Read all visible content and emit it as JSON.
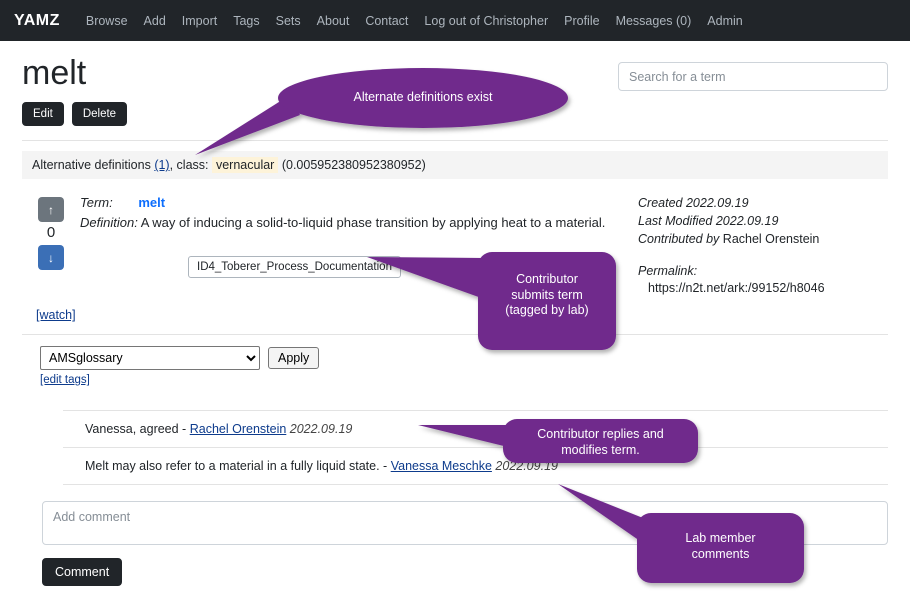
{
  "navbar": {
    "brand": "YAMZ",
    "items": [
      {
        "label": "Browse"
      },
      {
        "label": "Add"
      },
      {
        "label": "Import"
      },
      {
        "label": "Tags"
      },
      {
        "label": "Sets"
      },
      {
        "label": "About"
      },
      {
        "label": "Contact"
      },
      {
        "label": "Log out of Christopher"
      },
      {
        "label": "Profile"
      },
      {
        "label": "Messages (0)"
      },
      {
        "label": "Admin"
      }
    ]
  },
  "page": {
    "title": "melt",
    "edit_label": "Edit",
    "delete_label": "Delete"
  },
  "search": {
    "placeholder": "Search for a term",
    "value": ""
  },
  "alt_definitions": {
    "prefix": "Alternative definitions",
    "count_link": "(1)",
    "class_label": ", class:",
    "class_value": "vernacular",
    "score": "(0.005952380952380952)"
  },
  "term": {
    "vote_up_icon": "arrow-up-icon",
    "vote_down_icon": "arrow-down-icon",
    "vote_count": "0",
    "term_label": "Term:",
    "term_value": "melt",
    "definition_label": "Definition:",
    "definition_value": "A way of inducing a solid-to-liquid phase transition by applying heat to a material.",
    "tag_chip": "ID4_Toberer_Process_Documentation",
    "tag_remove_icon": "close-x-icon",
    "watch_link": "[watch]"
  },
  "meta": {
    "created_label": "Created",
    "created_value": "2022.09.19",
    "modified_label": "Last Modified",
    "modified_value": "2022.09.19",
    "contributed_label": "Contributed by",
    "contributed_value": "Rachel Orenstein",
    "permalink_label": "Permalink:",
    "permalink_value": "https://n2t.net/ark:/99152/h8046"
  },
  "tag_controls": {
    "selected_option": "AMSglossary",
    "apply_label": "Apply",
    "edit_tags_link": "[edit tags]"
  },
  "comments": [
    {
      "text": "Vanessa, agreed -",
      "author": "Rachel Orenstein",
      "date": "2022.09.19"
    },
    {
      "text": "Melt may also refer to a material in a fully liquid state. -",
      "author": "Vanessa Meschke",
      "date": "2022.09.19"
    }
  ],
  "comment_form": {
    "placeholder": "Add comment",
    "value": "",
    "submit_label": "Comment"
  },
  "annotations": {
    "color": "#6f2b8c",
    "items": [
      {
        "text": "Alternate definitions exist"
      },
      {
        "text": "Contributor\nsubmits term\n(tagged by lab)"
      },
      {
        "text": "Contributor replies and\nmodifies term."
      },
      {
        "text": "Lab member\ncomments"
      }
    ]
  },
  "colors": {
    "navbar_bg": "#212529",
    "accent_purple": "#6f2b8c",
    "link_blue": "#0d3b8c",
    "term_blue": "#0d6efd",
    "vote_down_blue": "#3b6fb6"
  }
}
